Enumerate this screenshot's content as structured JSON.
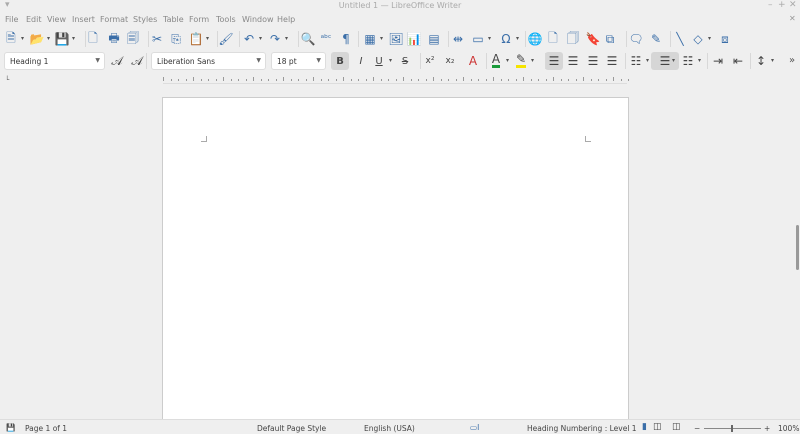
{
  "window": {
    "title": "Untitled 1 — LibreOffice Writer",
    "minimize": "–",
    "maximize": "+",
    "close": "✕",
    "doc_close": "✕",
    "menu_toggle": "▾"
  },
  "menu": [
    "File",
    "Edit",
    "View",
    "Insert",
    "Format",
    "Styles",
    "Table",
    "Form",
    "Tools",
    "Window",
    "Help"
  ],
  "toolbar_standard": [
    {
      "name": "new-document",
      "glyph": "🗎",
      "dd": true
    },
    {
      "name": "open",
      "glyph": "📂",
      "dd": true
    },
    {
      "name": "save",
      "glyph": "💾",
      "dd": true
    },
    {
      "name": "export-pdf",
      "glyph": "🗋"
    },
    {
      "name": "print",
      "glyph": "🖶"
    },
    {
      "name": "print-preview",
      "glyph": "🗐"
    },
    {
      "name": "cut",
      "glyph": "✂"
    },
    {
      "name": "copy",
      "glyph": "⎘"
    },
    {
      "name": "paste",
      "glyph": "📋",
      "dd": true
    },
    {
      "name": "clone-formatting",
      "glyph": "🖌"
    },
    {
      "name": "undo",
      "glyph": "↶",
      "dd": true
    },
    {
      "name": "redo",
      "glyph": "↷",
      "dd": true
    },
    {
      "name": "find-replace",
      "glyph": "🔍"
    },
    {
      "name": "spelling",
      "glyph": "ᵃᵇᶜ"
    },
    {
      "name": "formatting-marks",
      "glyph": "¶"
    },
    {
      "name": "insert-table",
      "glyph": "▦",
      "dd": true
    },
    {
      "name": "insert-image",
      "glyph": "🖼"
    },
    {
      "name": "insert-chart",
      "glyph": "📊"
    },
    {
      "name": "insert-textbox",
      "glyph": "▤"
    },
    {
      "name": "page-break",
      "glyph": "⇹"
    },
    {
      "name": "insert-field",
      "glyph": "▭",
      "dd": true
    },
    {
      "name": "special-character",
      "glyph": "Ω",
      "dd": true
    },
    {
      "name": "hyperlink",
      "glyph": "🌐"
    },
    {
      "name": "footnote",
      "glyph": "🗋"
    },
    {
      "name": "endnote",
      "glyph": "🗍"
    },
    {
      "name": "bookmark",
      "glyph": "🔖"
    },
    {
      "name": "cross-reference",
      "glyph": "⧉"
    },
    {
      "name": "comment",
      "glyph": "🗨"
    },
    {
      "name": "track-changes",
      "glyph": "✎"
    },
    {
      "name": "line",
      "glyph": "╲"
    },
    {
      "name": "basic-shapes",
      "glyph": "◇",
      "dd": true
    },
    {
      "name": "draw-functions",
      "glyph": "⧈"
    }
  ],
  "formatting": {
    "paragraph_style": "Heading 1",
    "font_name": "Liberation Sans",
    "font_size": "18 pt",
    "more": "»"
  },
  "toolbar_formatting": [
    {
      "name": "update-style",
      "glyph": "𝒜"
    },
    {
      "name": "new-style",
      "glyph": "𝒜"
    },
    {
      "name": "bold",
      "glyph": "B",
      "active": true
    },
    {
      "name": "italic",
      "glyph": "I"
    },
    {
      "name": "underline",
      "glyph": "U",
      "dd": true
    },
    {
      "name": "strikethrough",
      "glyph": "S"
    },
    {
      "name": "superscript",
      "glyph": "x²"
    },
    {
      "name": "subscript",
      "glyph": "x₂"
    },
    {
      "name": "clear-formatting",
      "glyph": "A"
    },
    {
      "name": "font-color",
      "glyph": "A",
      "dd": true
    },
    {
      "name": "highlight-color",
      "glyph": "✎",
      "dd": true
    },
    {
      "name": "align-left",
      "glyph": "☰",
      "active": true
    },
    {
      "name": "align-center",
      "glyph": "☰"
    },
    {
      "name": "align-right",
      "glyph": "☰"
    },
    {
      "name": "justify",
      "glyph": "☰"
    },
    {
      "name": "unordered-list",
      "glyph": "☷",
      "dd": true
    },
    {
      "name": "ordered-list",
      "glyph": "☰",
      "dd": true,
      "active": true
    },
    {
      "name": "outline",
      "glyph": "☷",
      "dd": true
    },
    {
      "name": "increase-indent",
      "glyph": "⇥"
    },
    {
      "name": "decrease-indent",
      "glyph": "⇤"
    },
    {
      "name": "line-spacing",
      "glyph": "↕",
      "dd": true
    }
  ],
  "status": {
    "page": "Page 1 of 1",
    "page_style": "Default Page Style",
    "language": "English (USA)",
    "outline": "Heading Numbering : Level 1",
    "zoom": "100%",
    "zoom_minus": "−",
    "zoom_plus": "+"
  },
  "colors": {
    "font_color": "#1a9a3a",
    "highlight": "#f5e400"
  }
}
